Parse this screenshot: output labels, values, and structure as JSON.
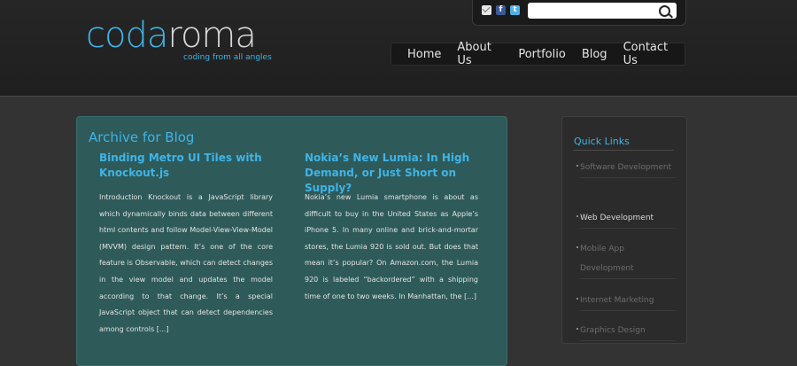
{
  "logo": {
    "word_part1": "coda",
    "word_part2": "roma",
    "tagline": "coding from all angles"
  },
  "search": {
    "placeholder": ""
  },
  "nav": {
    "items": [
      "Home",
      "About Us",
      "Portfolio",
      "Blog",
      "Contact Us"
    ]
  },
  "archive": {
    "title": "Archive for Blog"
  },
  "posts": [
    {
      "title": "Binding Metro UI Tiles with Knockout.js",
      "body": "Introduction Knockout is a JavaScript library which dynamically binds data between different html contents and follow Model-View-View-Model (MVVM) design pattern.  It’s one of the core feature is Observable, which can detect changes in the view model and updates the model according to that change. It’s a special JavaScript object that can detect dependencies among controls [...]"
    },
    {
      "title": "Nokia’s New Lumia: In High Demand, or Just Short on Supply?",
      "body": "Nokia’s new Lumia smartphone is about as difficult to buy in the United States as Apple’s iPhone 5. In many online and brick-and-mortar stores, the Lumia 920 is sold out. But does that mean it’s popular? On Amazon.com, the Lumia 920 is labeled “backordered” with a shipping time of one to two weeks. In Manhattan, the [...]"
    }
  ],
  "quick_links": {
    "title": "Quick Links",
    "items": [
      {
        "label": "Software Development",
        "active": false
      },
      {
        "label": "Web Development",
        "active": true
      },
      {
        "label": "Mobile App Development",
        "active": false
      },
      {
        "label": "Internet Marketing",
        "active": false
      },
      {
        "label": "Graphics Design",
        "active": false
      }
    ]
  },
  "colors": {
    "accent": "#3fb4e6",
    "main_panel": "#2e5a5a",
    "background": "#333333"
  },
  "icons": {
    "mail": "mail-icon",
    "facebook": "facebook-icon",
    "twitter": "twitter-icon",
    "search": "search-icon"
  }
}
